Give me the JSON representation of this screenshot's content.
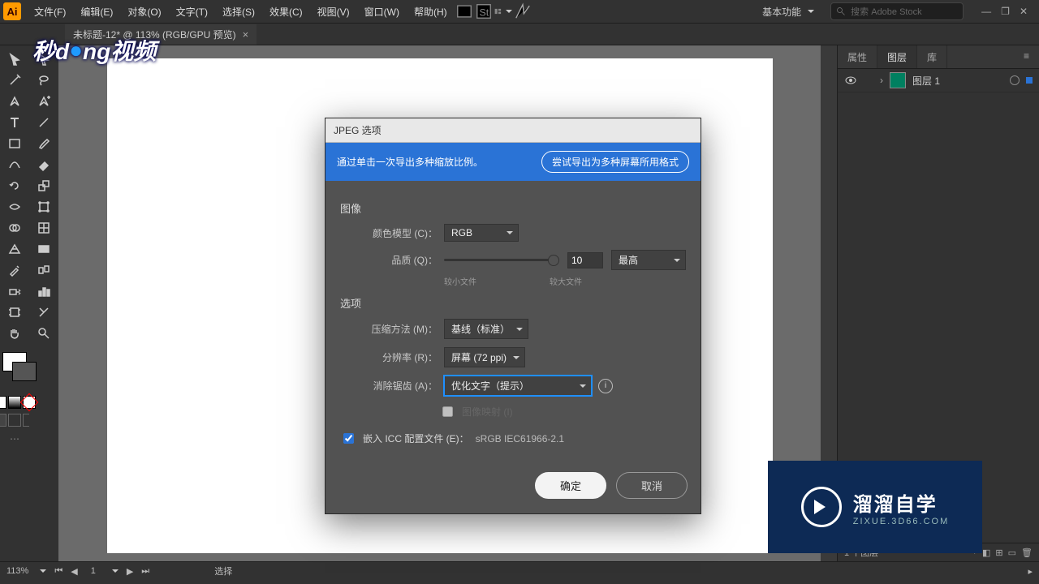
{
  "menubar": {
    "items": [
      "文件(F)",
      "编辑(E)",
      "对象(O)",
      "文字(T)",
      "选择(S)",
      "效果(C)",
      "视图(V)",
      "窗口(W)",
      "帮助(H)"
    ],
    "workspace": "基本功能",
    "search_placeholder": "搜索 Adobe Stock"
  },
  "tab": {
    "title": "未标题-12* @ 113% (RGB/GPU 预览)"
  },
  "dialog": {
    "title": "JPEG 选项",
    "banner_text": "通过单击一次导出多种缩放比例。",
    "banner_button": "尝试导出为多种屏幕所用格式",
    "section_image": "图像",
    "color_model_label": "颜色模型 (C)：",
    "color_model_value": "RGB",
    "quality_label": "品质 (Q)：",
    "quality_value": "10",
    "quality_preset": "最高",
    "quality_low": "较小文件",
    "quality_high": "较大文件",
    "section_options": "选项",
    "compress_label": "压缩方法 (M)：",
    "compress_value": "基线（标准）",
    "resolution_label": "分辨率 (R)：",
    "resolution_value": "屏幕 (72 ppi)",
    "antialias_label": "消除锯齿 (A)：",
    "antialias_value": "优化文字（提示）",
    "imagemap_label": "图像映射 (I)",
    "icc_label": "嵌入 ICC 配置文件 (E)：",
    "icc_value": "sRGB IEC61966-2.1",
    "ok": "确定",
    "cancel": "取消"
  },
  "right": {
    "tabs": [
      "属性",
      "图层",
      "库"
    ],
    "layer_name": "图层 1",
    "footer": "1 个图层"
  },
  "status": {
    "zoom": "113%",
    "artboard": "1",
    "mode": "选择"
  },
  "watermark": {
    "left": "秒dòng视频",
    "right_title": "溜溜自学",
    "right_url": "ZIXUE.3D66.COM"
  }
}
